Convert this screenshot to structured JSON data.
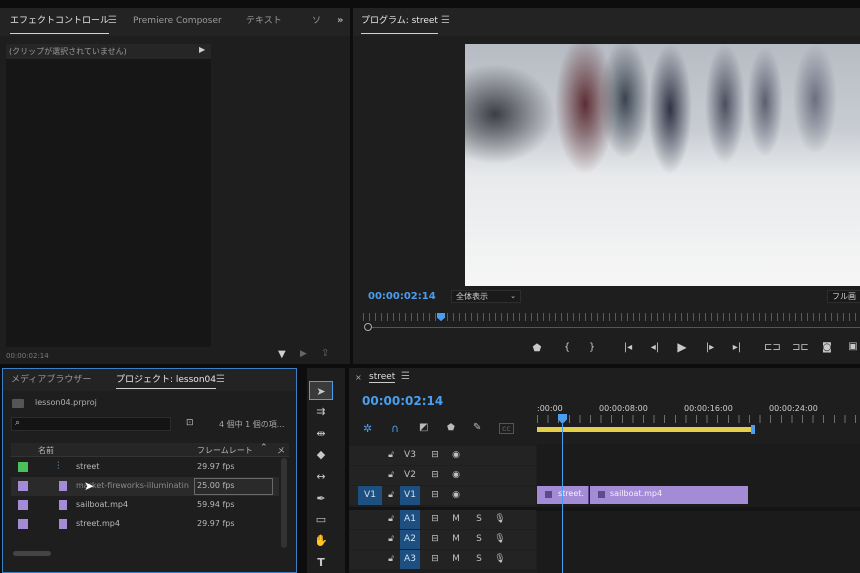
{
  "effect_controls": {
    "tabs": [
      "エフェクトコントロール",
      "Premiere Composer",
      "テキスト",
      "ソ"
    ],
    "no_clip_label": "(クリップが選択されていません)",
    "timecode": "00:00:02:14"
  },
  "program_monitor": {
    "title": "プログラム: street",
    "timecode": "00:00:02:14",
    "zoom_select": "全体表示",
    "quality_select": "フル画"
  },
  "project": {
    "tabs": [
      "メディアブラウザー",
      "プロジェクト: lesson04"
    ],
    "file_name": "lesson04.prproj",
    "search_placeholder": "",
    "item_count": "4 個中 1 個の項...",
    "columns": {
      "name": "名前",
      "frame_rate": "フレームレート",
      "more": "メ"
    },
    "items": [
      {
        "name": "street",
        "fps": "29.97 fps",
        "color": "#4bbf5b",
        "kind": "sequence"
      },
      {
        "name": "market-fireworks-illuminatin",
        "fps": "25.00 fps",
        "color": "#a38bd6",
        "kind": "clip"
      },
      {
        "name": "sailboat.mp4",
        "fps": "59.94 fps",
        "color": "#a38bd6",
        "kind": "clip"
      },
      {
        "name": "street.mp4",
        "fps": "29.97 fps",
        "color": "#a38bd6",
        "kind": "clip"
      }
    ]
  },
  "timeline": {
    "title": "street",
    "timecode": "00:00:02:14",
    "ruler": [
      ":00:00",
      "00:00:08:00",
      "00:00:16:00",
      "00:00:24:00"
    ],
    "video_tracks": [
      "V3",
      "V2",
      "V1"
    ],
    "audio_tracks": [
      "A1",
      "A2",
      "A3"
    ],
    "source_patch": "V1",
    "m_label": "M",
    "s_label": "S",
    "clips": [
      {
        "name": "street.",
        "track": "V1"
      },
      {
        "name": "sailboat.mp4",
        "track": "V1"
      }
    ]
  },
  "colors": {
    "accent": "#4a9eef",
    "clip": "#a38bd6",
    "work_area": "#e3cf4a",
    "panel": "#1e1e1e"
  }
}
